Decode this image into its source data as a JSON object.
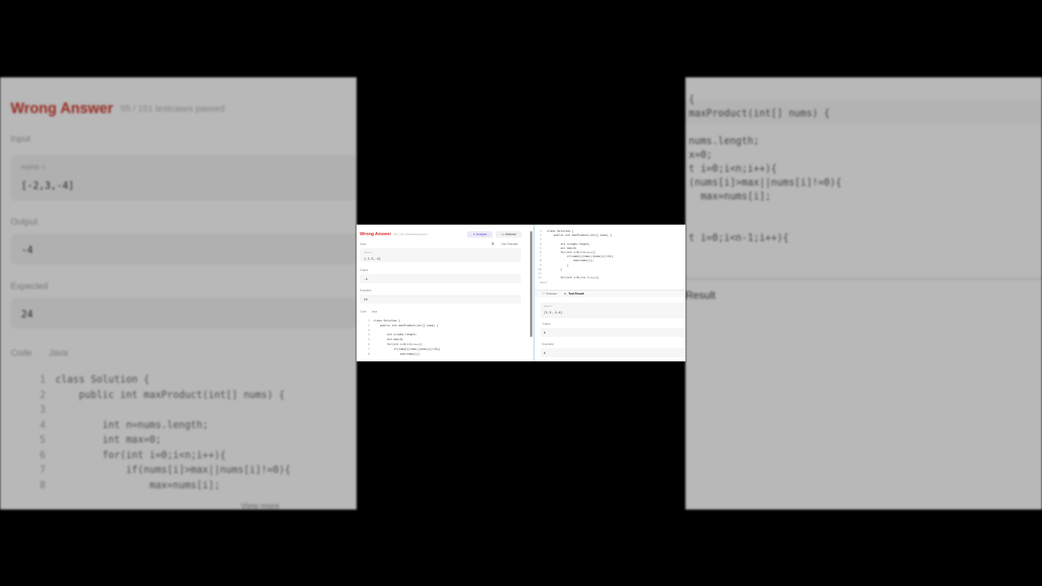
{
  "background_left": {
    "title": "Wrong Answer",
    "subtitle": "55 / 151 testcases passed",
    "input_label": "Input",
    "param_name": "nums =",
    "input_value": "[-2,3,-4]",
    "output_label": "Output",
    "output_value": "-4",
    "expected_label": "Expected",
    "expected_value": "24",
    "code_label": "Code",
    "language": "Java",
    "code_lines": [
      {
        "n": "1",
        "t": "class Solution {"
      },
      {
        "n": "2",
        "t": "    public int maxProduct(int[] nums) {"
      },
      {
        "n": "3",
        "t": ""
      },
      {
        "n": "4",
        "t": "        int n=nums.length;"
      },
      {
        "n": "5",
        "t": "        int max=0;"
      },
      {
        "n": "6",
        "t": "        for(int i=0;i<n;i++){"
      },
      {
        "n": "7",
        "t": "            if(nums[i]>max||nums[i]!=0){"
      },
      {
        "n": "8",
        "t": "                max=nums[i];"
      }
    ],
    "view_more": "View more"
  },
  "background_right": {
    "code_lines": [
      "{",
      "maxProduct(int[] nums) {",
      "",
      "nums.length;",
      "x=0;",
      "t i=0;i<n;i++){",
      "(nums[i]>max||nums[i]!=0){",
      "  max=nums[i];",
      "",
      "",
      "t i=0;i<n-1;i++){"
    ],
    "result_label": "Result"
  },
  "left_panel": {
    "title": "Wrong Answer",
    "subtitle": "55 / 151 testcases passed",
    "analysis_button": "Analysis",
    "editorial_button": "Editorial",
    "use_testcase": "Use Testcase",
    "input_label": "Input",
    "param_name": "nums =",
    "input_value": "[-2,3,-4]",
    "output_label": "Output",
    "output_value": "-4",
    "expected_label": "Expected",
    "expected_value": "24",
    "code_label": "Code",
    "language": "Java",
    "code_lines": [
      {
        "n": "1",
        "t": "class Solution {"
      },
      {
        "n": "2",
        "t": "    public int maxProduct(int[] nums) {"
      },
      {
        "n": "3",
        "t": ""
      },
      {
        "n": "4",
        "t": "        int n=nums.length;"
      },
      {
        "n": "5",
        "t": "        int max=0;"
      },
      {
        "n": "6",
        "t": "        for(int i=0;i<n;i++){"
      },
      {
        "n": "7",
        "t": "            if(nums[i]>max||nums[i]!=0){"
      },
      {
        "n": "8",
        "t": "                max=nums[i];"
      }
    ]
  },
  "right_panel": {
    "code_lines": [
      {
        "n": "1",
        "t": "class Solution {"
      },
      {
        "n": "2",
        "t": "    public int maxProduct(int[] nums) {"
      },
      {
        "n": "3",
        "t": ""
      },
      {
        "n": "4",
        "t": "        int n=nums.length;"
      },
      {
        "n": "5",
        "t": "        int max=0;"
      },
      {
        "n": "6",
        "t": "        for(int i=0;i<n;i++){"
      },
      {
        "n": "7",
        "t": "            if(nums[i]>max||nums[i]!=0){"
      },
      {
        "n": "8",
        "t": "                max=nums[i];"
      },
      {
        "n": "9",
        "t": "            }"
      },
      {
        "n": "10",
        "t": "        }"
      },
      {
        "n": "11",
        "t": ""
      },
      {
        "n": "12",
        "t": "        for(int i=0;i<n-1;i++){"
      }
    ],
    "saved_label": "Saved",
    "testcase_tab": "Testcase",
    "test_result_tab": "Test Result",
    "param_name": "nums =",
    "input_value": "[2,3,-2,4]",
    "output_label": "Output",
    "output_value": "6",
    "expected_label": "Expected",
    "expected_value": "6"
  },
  "colors": {
    "error_red": "#d32f2f",
    "analysis_purple": "#5b4bd6",
    "divider_teal": "#cfe7ee"
  }
}
